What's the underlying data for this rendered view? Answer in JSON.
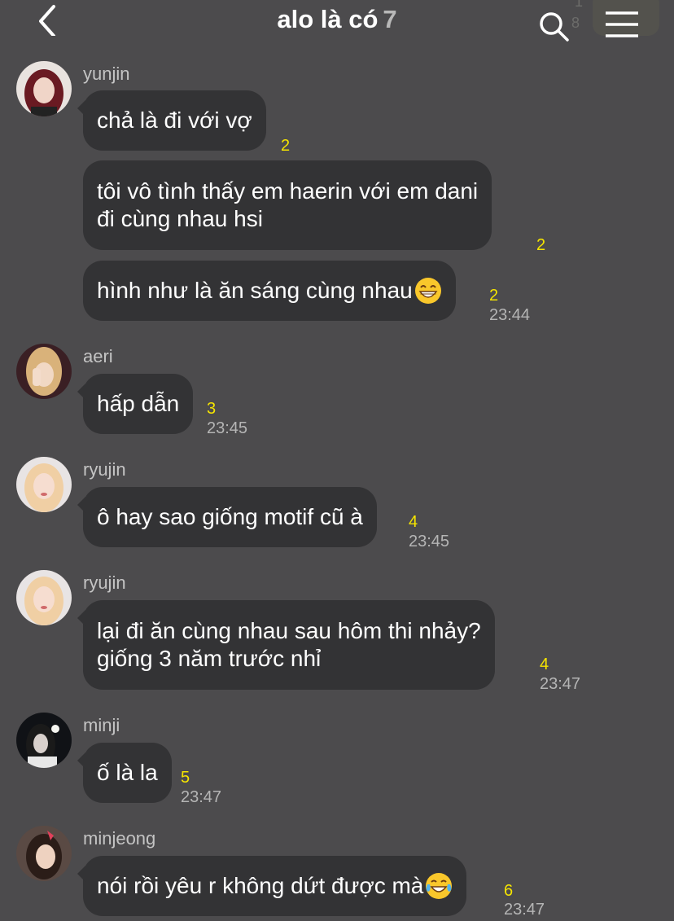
{
  "header": {
    "title": "alo là có",
    "member_count": "7",
    "back_icon": "chevron-left-icon",
    "search_icon": "search-icon",
    "menu_icon": "hamburger-menu-icon",
    "ghost_numbers": [
      "1",
      "8"
    ]
  },
  "messages": [
    {
      "sender": "yunjin",
      "text": "chả là đi với vợ",
      "read": "2"
    },
    {
      "text_lines": [
        "tôi vô tình thấy em haerin với em dani",
        "đi cùng nhau hsi"
      ],
      "read": "2"
    },
    {
      "text": "hình như là ăn sáng cùng nhau",
      "emoji": "grinning-face-emoji",
      "read": "2",
      "time": "23:44"
    },
    {
      "sender": "aeri",
      "text": "hấp dẫn",
      "read": "3",
      "time": "23:45"
    },
    {
      "sender": "ryujin",
      "text": "ô hay sao giống motif cũ à",
      "read": "4",
      "time": "23:45"
    },
    {
      "sender": "ryujin",
      "text_lines": [
        "lại đi ăn cùng nhau sau hôm thi nhảy?",
        "giống 3 năm trước nhỉ"
      ],
      "read": "4",
      "time": "23:47"
    },
    {
      "sender": "minji",
      "text": "ố là la",
      "read": "5",
      "time": "23:47"
    },
    {
      "sender": "minjeong",
      "text": "nói rồi yêu r không dứt được mà",
      "emoji": "tears-of-joy-emoji",
      "read": "6",
      "time": "23:47"
    }
  ]
}
